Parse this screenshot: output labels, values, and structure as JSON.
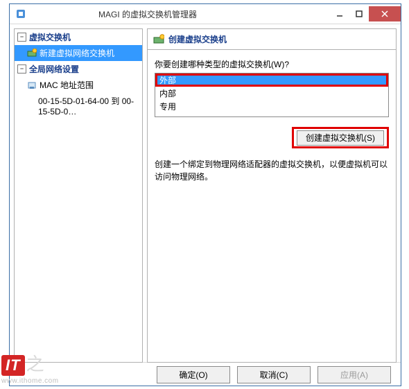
{
  "window": {
    "title": "MAGI 的虚拟交换机管理器"
  },
  "tree": {
    "groups": [
      {
        "label": "虚拟交换机",
        "items": [
          {
            "label": "新建虚拟网络交换机",
            "selected": true
          }
        ]
      },
      {
        "label": "全局网络设置",
        "items": [
          {
            "label": "MAC 地址范围",
            "detail": "00-15-5D-01-64-00 到 00-15-5D-0…"
          }
        ]
      }
    ]
  },
  "panel": {
    "title": "创建虚拟交换机",
    "prompt": "你要创建哪种类型的虚拟交换机(W)?",
    "types": [
      "外部",
      "内部",
      "专用"
    ],
    "selected_type_index": 0,
    "create_button": "创建虚拟交换机(S)",
    "description": "创建一个绑定到物理网络适配器的虚拟交换机，以便虚拟机可以访问物理网络。"
  },
  "footer": {
    "ok": "确定(O)",
    "cancel": "取消(C)",
    "apply": "应用(A)"
  },
  "watermark": {
    "badge": "IT",
    "suffix": "之",
    "url": "www.ithome.com"
  },
  "colors": {
    "selection": "#3399ff",
    "highlight_border": "#e00000",
    "close_button": "#c75050",
    "link_text": "#1a3f8b"
  }
}
